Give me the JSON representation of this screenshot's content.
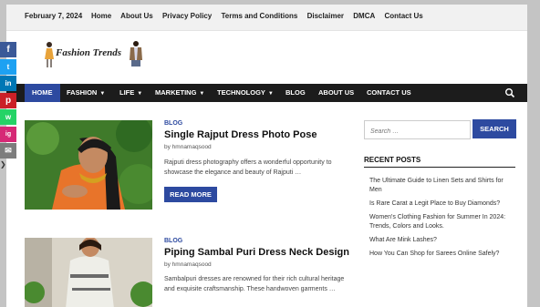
{
  "topbar": {
    "date": "February 7, 2024",
    "links": [
      "Home",
      "About Us",
      "Privacy Policy",
      "Terms and Conditions",
      "Disclaimer",
      "DMCA",
      "Contact Us"
    ]
  },
  "logo": {
    "text": "Fashion Trends"
  },
  "nav": {
    "items": [
      {
        "label": "HOME"
      },
      {
        "label": "FASHION"
      },
      {
        "label": "LIFE"
      },
      {
        "label": "MARKETING"
      },
      {
        "label": "TECHNOLOGY"
      },
      {
        "label": "BLOG"
      },
      {
        "label": "ABOUT US"
      },
      {
        "label": "CONTACT US"
      }
    ]
  },
  "social": [
    "f",
    "t",
    "in",
    "p",
    "w",
    "ig",
    "✉"
  ],
  "posts": [
    {
      "category": "BLOG",
      "title": "Single Rajput Dress Photo Pose",
      "author": "by hmnamaqsood",
      "excerpt": "Rajputi dress photography offers a wonderful opportunity to showcase the elegance and beauty of Rajputi …",
      "button": "READ MORE"
    },
    {
      "category": "BLOG",
      "title": "Piping Sambal Puri Dress Neck Design",
      "author": "by hmnamaqsood",
      "excerpt": "Sambalpuri dresses are renowned for their rich cultural heritage and exquisite craftsmanship. These handwoven garments …"
    }
  ],
  "sidebar": {
    "search_placeholder": "Search …",
    "search_button": "SEARCH",
    "recent_title": "RECENT POSTS",
    "recent_posts": [
      "The Ultimate Guide to Linen Sets and Shirts for Men",
      "Is Rare Carat a Legit Place to Buy Diamonds?",
      "Women's Clothing Fashion for Summer In 2024: Trends, Colors and Looks.",
      "What Are Mink Lashes?",
      "How You Can Shop for Sarees Online Safely?"
    ]
  },
  "colors": {
    "accent": "#2d4aa0",
    "navbar": "#1c1c1c"
  }
}
